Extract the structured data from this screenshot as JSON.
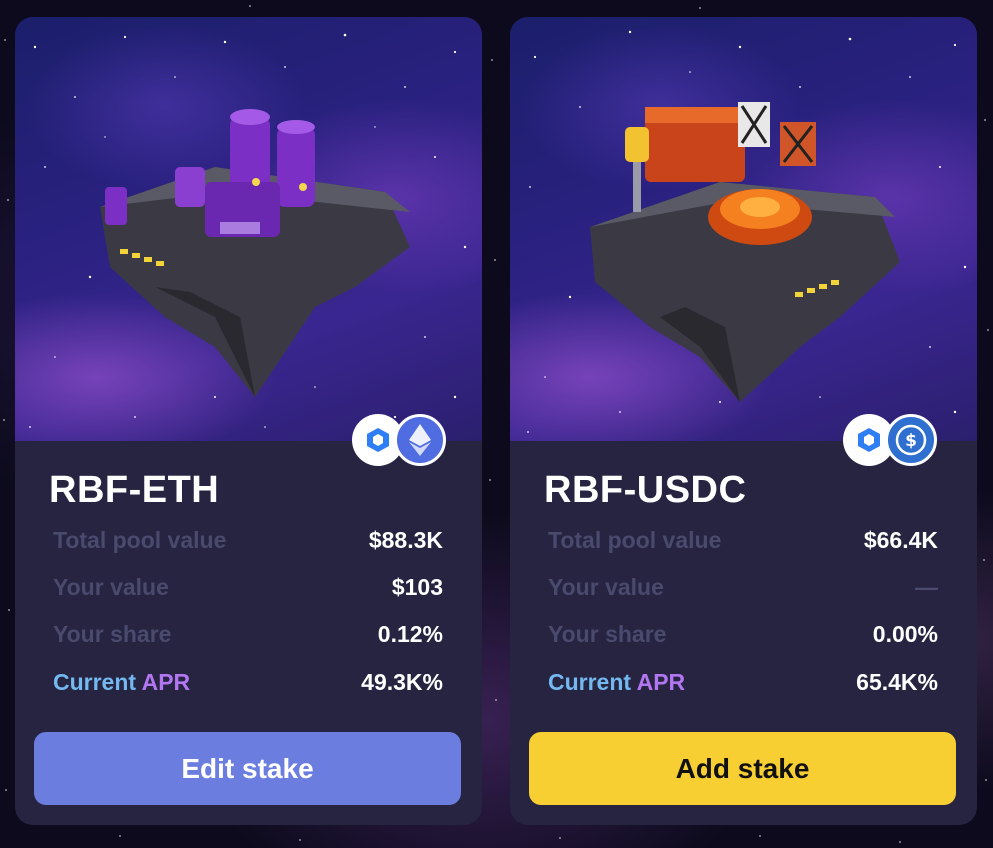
{
  "cards": [
    {
      "title": "RBF-ETH",
      "token_icons": [
        "hexagon-icon",
        "ethereum-icon"
      ],
      "rows": [
        {
          "label": "Total pool value",
          "value": "$88.3K"
        },
        {
          "label": "Your value",
          "value": "$103"
        },
        {
          "label": "Your share",
          "value": "0.12%"
        }
      ],
      "apr": {
        "label_part1": "Current",
        "label_part2": "APR",
        "value": "49.3K%"
      },
      "button_label": "Edit stake"
    },
    {
      "title": "RBF-USDC",
      "token_icons": [
        "hexagon-icon",
        "usdc-icon"
      ],
      "rows": [
        {
          "label": "Total pool value",
          "value": "$66.4K"
        },
        {
          "label": "Your value",
          "value": "—"
        },
        {
          "label": "Your share",
          "value": "0.00%"
        }
      ],
      "apr": {
        "label_part1": "Current",
        "label_part2": "APR",
        "value": "65.4K%"
      },
      "button_label": "Add stake"
    }
  ],
  "colors": {
    "card_bg": "#262440",
    "label_muted": "#4a4a6e",
    "apr_blue": "#74b8f0",
    "apr_purple": "#b176f0",
    "edit_button": "#6b7ee0",
    "add_button": "#f7cf32"
  }
}
